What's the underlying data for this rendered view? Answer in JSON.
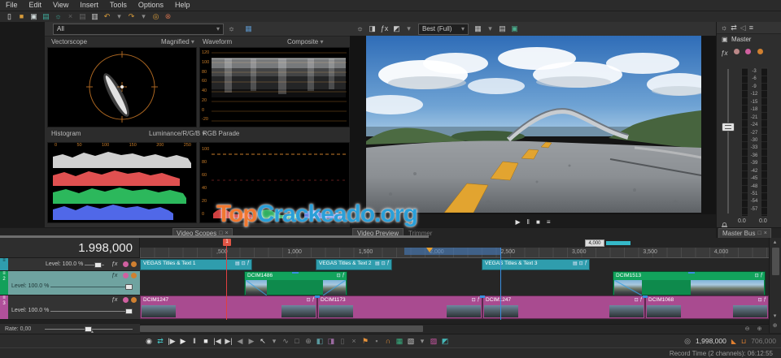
{
  "menu": {
    "items": [
      "File",
      "Edit",
      "View",
      "Insert",
      "Tools",
      "Options",
      "Help"
    ]
  },
  "ui": {
    "caret": "▾",
    "float": "□",
    "close": "×",
    "up": "▴",
    "down": "▾",
    "zoom_in": "⊕",
    "zoom_out": "⊖",
    "hamburger": "≡",
    "tick": "▴"
  },
  "toolbar": {
    "icons": [
      {
        "name": "new-project-icon",
        "glyph": "▯",
        "color": "#e8e8e8"
      },
      {
        "name": "open-project-icon",
        "glyph": "■",
        "color": "#d79b3b"
      },
      {
        "name": "save-project-icon",
        "glyph": "▣",
        "color": "#cfd8d8"
      },
      {
        "name": "render-as-icon",
        "glyph": "▤",
        "color": "#3fae9e"
      },
      {
        "name": "project-properties-icon",
        "glyph": "☼",
        "color": "#3fae9e"
      },
      {
        "name": "cut-icon",
        "glyph": "×",
        "color": "#636363"
      },
      {
        "name": "copy-icon",
        "glyph": "▤",
        "color": "#636363"
      },
      {
        "name": "paste-icon",
        "glyph": "▥",
        "color": "#cfcfcf"
      },
      {
        "name": "undo-icon",
        "glyph": "↶",
        "color": "#d79b3b"
      },
      {
        "name": "undo-caret-icon",
        "glyph": "▾",
        "color": "#8a8a8a"
      },
      {
        "name": "redo-icon",
        "glyph": "↷",
        "color": "#d79b3b"
      },
      {
        "name": "redo-caret-icon",
        "glyph": "▾",
        "color": "#8a8a8a"
      },
      {
        "name": "interactive-tutorials-icon",
        "glyph": "◎",
        "color": "#d79b3b"
      },
      {
        "name": "whats-this-help-icon",
        "glyph": "⊗",
        "color": "#c06a4a"
      }
    ]
  },
  "scopes": {
    "filter": {
      "value": "All"
    },
    "top_icons": [
      {
        "name": "scope-settings-icon",
        "glyph": "☼",
        "color": "#c8c8c8"
      },
      {
        "name": "scope-update-icon",
        "glyph": "▦",
        "color": "#5a8fc0"
      }
    ],
    "vectorscope": {
      "label": "Vectorscope",
      "mode": "Magnified"
    },
    "waveform": {
      "label": "Waveform",
      "mode": "Composite",
      "scale": [
        "120",
        "100",
        "80",
        "60",
        "40",
        "20",
        "0",
        "-20"
      ]
    },
    "histogram": {
      "label": "Histogram",
      "mode": "Luminance/R/G/B",
      "axis": [
        "0",
        "50",
        "100",
        "150",
        "200",
        "250"
      ]
    },
    "rgb_parade": {
      "label": "RGB Parade",
      "scale": [
        "100",
        "80",
        "60",
        "40",
        "20",
        "0"
      ]
    },
    "tab": "Video Scopes"
  },
  "preview": {
    "toolbar_icons_left": [
      {
        "name": "preview-settings-icon",
        "glyph": "☼",
        "color": "#c8c8c8"
      },
      {
        "name": "external-monitor-icon",
        "glyph": "◨",
        "color": "#c8c8c8"
      },
      {
        "name": "video-output-fx-icon",
        "glyph": "ƒx",
        "color": "#c8c8c8"
      },
      {
        "name": "split-screen-icon",
        "glyph": "◩",
        "color": "#c8c8c8"
      },
      {
        "name": "split-screen-caret-icon",
        "glyph": "▾",
        "color": "#8a8a8a"
      }
    ],
    "quality": "Best (Full)",
    "toolbar_icons_right": [
      {
        "name": "overlays-grid-icon",
        "glyph": "▦",
        "color": "#c8c8c8"
      },
      {
        "name": "overlays-caret-icon",
        "glyph": "▾",
        "color": "#8a8a8a"
      },
      {
        "name": "copy-snapshot-icon",
        "glyph": "▤",
        "color": "#c8c8c8"
      },
      {
        "name": "save-snapshot-icon",
        "glyph": "▣",
        "color": "#4aae8e"
      }
    ],
    "transport": [
      {
        "name": "preview-play-button",
        "glyph": "▶",
        "color": "#e0e0e0"
      },
      {
        "name": "preview-pause-button",
        "glyph": "‖",
        "color": "#e0e0e0"
      },
      {
        "name": "preview-stop-button",
        "glyph": "■",
        "color": "#e0e0e0"
      },
      {
        "name": "preview-menu-button",
        "glyph": "≡",
        "color": "#e0e0e0"
      }
    ],
    "tabs": [
      {
        "label": "Video Preview",
        "active": true
      },
      {
        "label": "Trimmer",
        "active": false
      }
    ]
  },
  "master_bus": {
    "toolbar_icons": [
      {
        "name": "mixer-settings-icon",
        "glyph": "☼",
        "color": "#c8c8c8"
      },
      {
        "name": "downmix-output-icon",
        "glyph": "⇄",
        "color": "#c8c8c8"
      },
      {
        "name": "dim-output-icon",
        "glyph": "◁",
        "color": "#8a8a8a"
      },
      {
        "name": "meter-options-icon",
        "glyph": "≡",
        "color": "#c8c8c8"
      }
    ],
    "title": "Master",
    "fx_label": "ƒx",
    "scale": [
      "-3",
      "-6",
      "-9",
      "-12",
      "-15",
      "-18",
      "-21",
      "-24",
      "-27",
      "-30",
      "-33",
      "-36",
      "-39",
      "-42",
      "-45",
      "-48",
      "-51",
      "-54",
      "-57"
    ],
    "left_value": "0.0",
    "right_value": "0.0",
    "tab": "Master Bus"
  },
  "timeline": {
    "time_display": "1.998,000",
    "ruler_labels": [
      ",500",
      "1,000",
      "1,500",
      "2,000",
      "2,500",
      "3,000",
      "3,500",
      "4,000"
    ],
    "marker_number": "1",
    "region_label": "4,000",
    "tracks": [
      {
        "number": "",
        "level_label": "Level: 100.0 %",
        "clips": [
          {
            "name": "VEGAS Titles & Text 1"
          },
          {
            "name": "VEGAS Titles & Text 2"
          },
          {
            "name": "VEGAS Titles & Text 3"
          }
        ]
      },
      {
        "number": "2",
        "level_label": "Level: 100.0 %",
        "clips": [
          {
            "name": "DCIM1486"
          },
          {
            "name": "DCIM1513"
          }
        ]
      },
      {
        "number": "3",
        "level_label": "Level: 100.0 %",
        "clips": [
          {
            "name": "DCIM1247"
          },
          {
            "name": "DCIM1173"
          },
          {
            "name": "DCIM1247"
          },
          {
            "name": "DCIM1068"
          }
        ]
      }
    ]
  },
  "clip_icons": {
    "media": "▤",
    "crop": "⊡",
    "fx": "ƒ"
  },
  "transport_bar": {
    "icons": [
      {
        "name": "record-button",
        "glyph": "◉",
        "color": "#d8d8d8"
      },
      {
        "name": "loop-playback-button",
        "glyph": "⇄",
        "color": "#45c8c8"
      },
      {
        "name": "play-from-start-button",
        "glyph": "|▶",
        "color": "#d8d8d8"
      },
      {
        "name": "play-button",
        "glyph": "▶",
        "color": "#e8e8e8"
      },
      {
        "name": "pause-button",
        "glyph": "‖",
        "color": "#e8e8e8"
      },
      {
        "name": "stop-button",
        "glyph": "■",
        "color": "#e8e8e8"
      },
      {
        "name": "go-to-start-button",
        "glyph": "|◀",
        "color": "#d0d0d0"
      },
      {
        "name": "go-to-end-button",
        "glyph": "▶|",
        "color": "#d0d0d0"
      },
      {
        "name": "previous-frame-button",
        "glyph": "◀",
        "color": "#8a8a8a"
      },
      {
        "name": "next-frame-button",
        "glyph": "▶",
        "color": "#8a8a8a"
      },
      {
        "name": "edit-tool-button",
        "glyph": "↖",
        "color": "#e0e0e0"
      },
      {
        "name": "edit-tool-caret-icon",
        "glyph": "▾",
        "color": "#909090"
      },
      {
        "name": "envelope-tool-button",
        "glyph": "∿",
        "color": "#8a8a8a"
      },
      {
        "name": "selection-tool-button",
        "glyph": "□",
        "color": "#8a8a8a"
      },
      {
        "name": "zoom-tool-button",
        "glyph": "⊕",
        "color": "#8a8a8a"
      },
      {
        "name": "trim-tool-button",
        "glyph": "◧",
        "color": "#5a9aa0"
      },
      {
        "name": "split-tool-button",
        "glyph": "◨",
        "color": "#9a6aa0"
      },
      {
        "name": "snap-toggle-button",
        "glyph": "▯",
        "color": "#6a6a6a"
      },
      {
        "name": "delete-button",
        "glyph": "×",
        "color": "#7a7a7a"
      },
      {
        "name": "insert-marker-button",
        "glyph": "⚑",
        "color": "#e8923a"
      },
      {
        "name": "lock-envelopes-button",
        "glyph": "▪",
        "color": "#7a7a7a"
      },
      {
        "name": "auto-ripple-button",
        "glyph": "∩",
        "color": "#e8923a"
      },
      {
        "name": "envelope-edit-button",
        "glyph": "▦",
        "color": "#38b080"
      },
      {
        "name": "more-tools-button",
        "glyph": "▧",
        "color": "#c8c8c8"
      },
      {
        "name": "more-tools-caret-icon",
        "glyph": "▾",
        "color": "#909090"
      },
      {
        "name": "pink-tool-button",
        "glyph": "▨",
        "color": "#d058a8"
      },
      {
        "name": "teal-tool-button",
        "glyph": "◩",
        "color": "#45b8b8"
      }
    ],
    "right": {
      "pin": "◎",
      "tri": "◣",
      "bracket": "⊔"
    },
    "position": "1,998,000",
    "selection_end": "706,000"
  },
  "rate": {
    "label": "Rate: 0,00"
  },
  "status": {
    "text": "Record Time (2 channels): 06:12:55"
  },
  "watermark": {
    "prefix": "Top",
    "suffix": "Crackeado.org"
  }
}
